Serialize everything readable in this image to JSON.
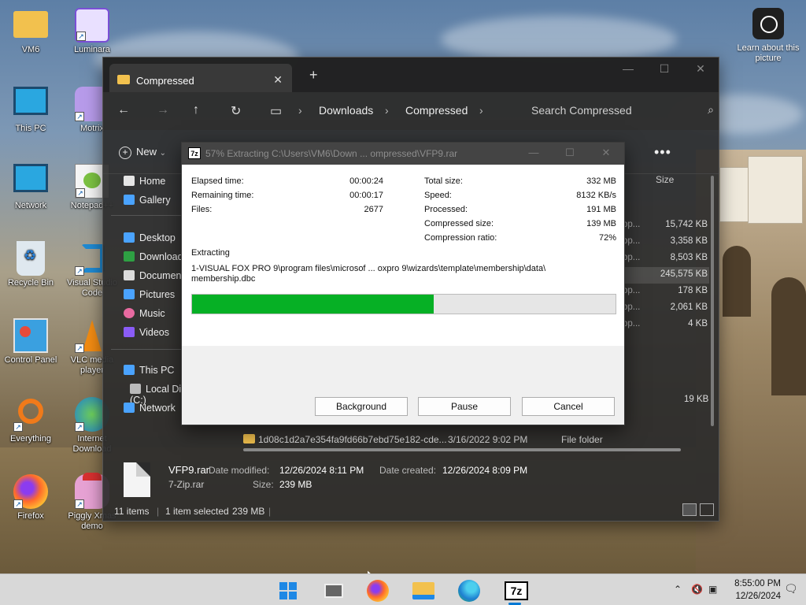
{
  "desktop": {
    "icons": [
      {
        "label": "VM6"
      },
      {
        "label": "Luminara"
      },
      {
        "label": "This PC"
      },
      {
        "label": "Motrix"
      },
      {
        "label": "Network"
      },
      {
        "label": "Notepad++"
      },
      {
        "label": "Recycle Bin"
      },
      {
        "label": "Visual Studio Code"
      },
      {
        "label": "Control Panel"
      },
      {
        "label": "VLC media player"
      },
      {
        "label": "Everything"
      },
      {
        "label": "Internet Download"
      },
      {
        "label": "Firefox"
      },
      {
        "label": "Piggly Xmas demo"
      }
    ],
    "learn_about": "Learn about this picture"
  },
  "explorer": {
    "tab_title": "Compressed",
    "new_tab": "+",
    "window_buttons": [
      "—",
      "☐",
      "✕"
    ],
    "breadcrumbs": [
      "Downloads",
      "Compressed"
    ],
    "search_placeholder": "Search Compressed",
    "new_button": "New",
    "more_button": "•••",
    "sidebar": [
      {
        "label": "Home",
        "color": "#e5e5e5"
      },
      {
        "label": "Gallery",
        "color": "#4aa3ff"
      },
      {
        "label": "Desktop",
        "color": "#4aa3ff"
      },
      {
        "label": "Downloads",
        "color": "#2ea043"
      },
      {
        "label": "Documents",
        "color": "#dcdcdc"
      },
      {
        "label": "Pictures",
        "color": "#4aa3ff"
      },
      {
        "label": "Music",
        "color": "#e86aa0"
      },
      {
        "label": "Videos",
        "color": "#8a5cf6"
      },
      {
        "label": "This PC",
        "color": "#4aa3ff"
      },
      {
        "label": "Local Disk (C:)",
        "color": "#bbbbbb"
      },
      {
        "label": "Network",
        "color": "#4aa3ff"
      }
    ],
    "size_header": "Size",
    "sizes": [
      {
        "pre": "op...",
        "size": "15,742 KB"
      },
      {
        "pre": "op...",
        "size": "3,358 KB"
      },
      {
        "pre": "op...",
        "size": "8,503 KB"
      },
      {
        "pre": "",
        "size": "245,575 KB"
      },
      {
        "pre": "op...",
        "size": "178 KB"
      },
      {
        "pre": "op...",
        "size": "2,061 KB"
      },
      {
        "pre": "op...",
        "size": "4 KB"
      }
    ],
    "extra_size": "19 KB",
    "folder_row": {
      "name": "1d08c1d2a7e354fa9fd66b7ebd75e182-cde...",
      "date": "3/16/2022 9:02 PM",
      "type": "File folder"
    },
    "details": {
      "file_name": "VFP9.rar",
      "file_type": "7-Zip.rar",
      "date_modified_label": "Date modified:",
      "date_modified": "12/26/2024 8:11 PM",
      "date_created_label": "Date created:",
      "date_created": "12/26/2024 8:09 PM",
      "size_label": "Size:",
      "size": "239 MB"
    },
    "status": {
      "items": "11 items",
      "selected": "1 item selected",
      "selected_size": "239 MB"
    }
  },
  "dialog": {
    "title": "57% Extracting C:\\Users\\VM6\\Down ... ompressed\\VFP9.rar",
    "elapsed_label": "Elapsed time:",
    "elapsed": "00:00:24",
    "remaining_label": "Remaining time:",
    "remaining": "00:00:17",
    "files_label": "Files:",
    "files": "2677",
    "total_size_label": "Total size:",
    "total_size": "332 MB",
    "speed_label": "Speed:",
    "speed": "8132 KB/s",
    "processed_label": "Processed:",
    "processed": "191 MB",
    "compressed_size_label": "Compressed size:",
    "compressed_size": "139 MB",
    "compression_ratio_label": "Compression ratio:",
    "compression_ratio": "72%",
    "extracting_label": "Extracting",
    "path_line1": "1-VISUAL FOX PRO 9\\program files\\microsof ... oxpro 9\\wizards\\template\\membership\\data\\",
    "path_line2": "membership.dbc",
    "progress": 0.57,
    "progress_color": "#06b025",
    "buttons": {
      "background": "Background",
      "pause": "Pause",
      "cancel": "Cancel"
    }
  },
  "taskbar": {
    "clock_time": "8:55:00 PM",
    "clock_date": "12/26/2024",
    "seven_zip_label": "7z"
  }
}
